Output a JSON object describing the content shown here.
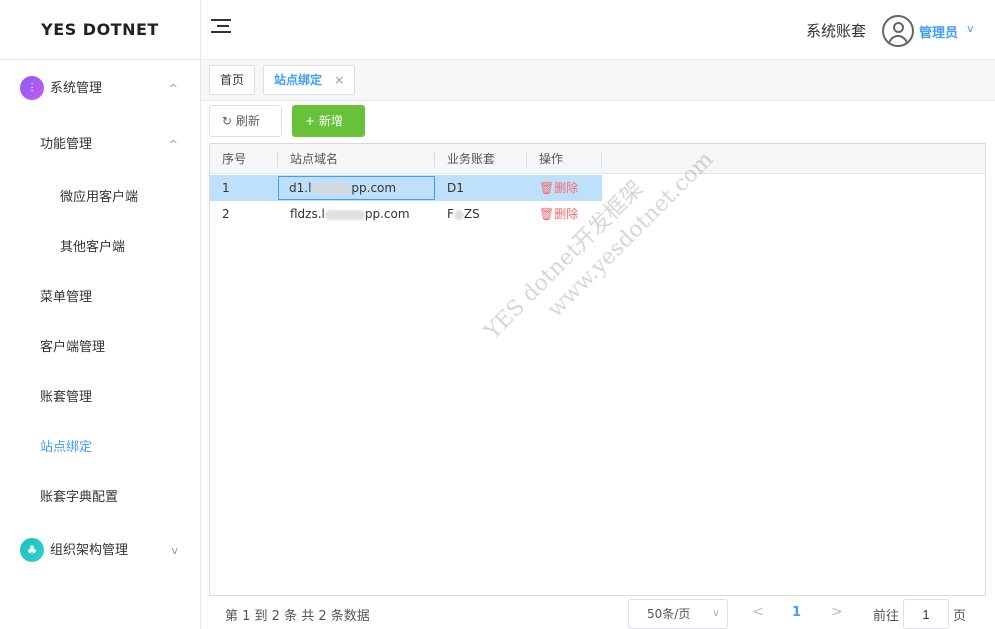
{
  "app": {
    "logo": "YES DOTNET"
  },
  "sidebar": {
    "items": [
      {
        "label": "系统管理",
        "chevron": "^"
      },
      {
        "label": "功能管理",
        "chevron": "^"
      },
      {
        "label": "微应用客户端"
      },
      {
        "label": "其他客户端"
      },
      {
        "label": "菜单管理"
      },
      {
        "label": "客户端管理"
      },
      {
        "label": "账套管理"
      },
      {
        "label": "站点绑定"
      },
      {
        "label": "账套字典配置"
      },
      {
        "label": "组织架构管理",
        "chevron": "v"
      }
    ],
    "active_color": "#409eff"
  },
  "header": {
    "account_label": "系统账套",
    "user_name": "管理员",
    "user_chevron": "v"
  },
  "tabs": [
    {
      "label": "首页"
    },
    {
      "label": "站点绑定",
      "close": "×"
    }
  ],
  "toolbar": {
    "refresh_icon": "↻",
    "refresh_label": "刷新",
    "add_icon": "+",
    "add_label": "新增"
  },
  "table": {
    "columns": [
      "序号",
      "站点域名",
      "业务账套",
      "操作"
    ],
    "rows": [
      {
        "index": "1",
        "domain_a": "d1.l",
        "domain_b": "pp.com",
        "account": "D1",
        "action": "删除"
      },
      {
        "index": "2",
        "domain_a": "fldzs.l",
        "domain_b": "pp.com",
        "account_a": "F",
        "account_b": "ZS",
        "action": "删除"
      }
    ]
  },
  "watermark": {
    "line1": "YES dotnet开发框架",
    "line2": "www.yesdotnet.com"
  },
  "pagination": {
    "info": "第 1 到 2 条 共 2 条数据",
    "page_size": "50条/页",
    "prev": "<",
    "current": "1",
    "next": ">",
    "goto_prefix": "前往",
    "goto_value": "1",
    "goto_suffix": "页"
  },
  "colors": {
    "primary": "#409eff",
    "success": "#67c23a",
    "danger": "#f56c6c",
    "selected_row": "#bfe0fb"
  }
}
